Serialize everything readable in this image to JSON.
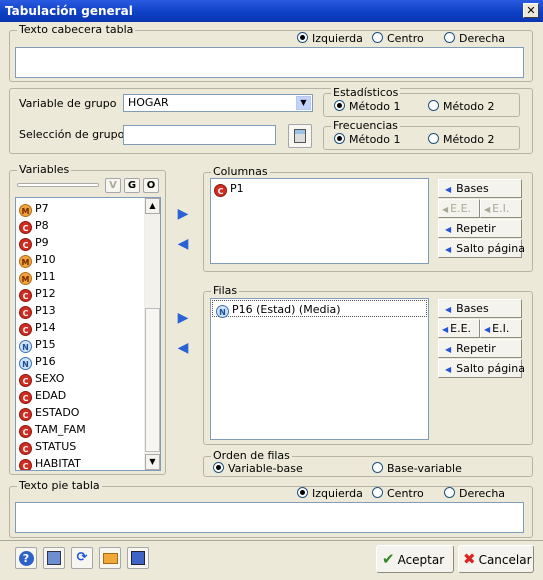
{
  "window": {
    "title": "Tabulación general",
    "close_glyph": "✕"
  },
  "header_text": {
    "label": "Texto cabecera tabla",
    "value": "",
    "alignment_options": [
      {
        "label": "Izquierda",
        "selected": true
      },
      {
        "label": "Centro",
        "selected": false
      },
      {
        "label": "Derecha",
        "selected": false
      }
    ]
  },
  "group_var": {
    "label": "Variable de grupo",
    "value": "HOGAR"
  },
  "group_sel": {
    "label": "Selección de grupo",
    "value": ""
  },
  "estadisticos": {
    "label": "Estadísticos",
    "options": [
      {
        "label": "Método 1",
        "selected": true
      },
      {
        "label": "Método 2",
        "selected": false
      }
    ]
  },
  "frecuencias": {
    "label": "Frecuencias",
    "options": [
      {
        "label": "Método 1",
        "selected": true
      },
      {
        "label": "Método 2",
        "selected": false
      }
    ]
  },
  "variables": {
    "label": "Variables",
    "filter_buttons": [
      "V",
      "G",
      "O"
    ],
    "items": [
      {
        "type": "M",
        "name": "P7"
      },
      {
        "type": "C",
        "name": "P8"
      },
      {
        "type": "C",
        "name": "P9"
      },
      {
        "type": "M",
        "name": "P10"
      },
      {
        "type": "M",
        "name": "P11"
      },
      {
        "type": "C",
        "name": "P12"
      },
      {
        "type": "C",
        "name": "P13"
      },
      {
        "type": "C",
        "name": "P14"
      },
      {
        "type": "N",
        "name": "P15"
      },
      {
        "type": "N",
        "name": "P16"
      },
      {
        "type": "C",
        "name": "SEXO"
      },
      {
        "type": "C",
        "name": "EDAD"
      },
      {
        "type": "C",
        "name": "ESTADO"
      },
      {
        "type": "C",
        "name": "TAM_FAM"
      },
      {
        "type": "C",
        "name": "STATUS"
      },
      {
        "type": "C",
        "name": "HABITAT"
      }
    ]
  },
  "columnas": {
    "label": "Columnas",
    "items": [
      {
        "type": "C",
        "name": "P1"
      }
    ],
    "buttons": {
      "bases": "Bases",
      "ee": "E.E.",
      "ei": "E.I.",
      "repetir": "Repetir",
      "salto": "Salto página"
    }
  },
  "filas": {
    "label": "Filas",
    "items": [
      {
        "type": "N",
        "name": "P16  (Estad)  (Media)"
      }
    ],
    "buttons": {
      "bases": "Bases",
      "ee": "E.E.",
      "ei": "E.I.",
      "repetir": "Repetir",
      "salto": "Salto página"
    }
  },
  "orden": {
    "label": "Orden de filas",
    "options": [
      {
        "label": "Variable-base",
        "selected": true
      },
      {
        "label": "Base-variable",
        "selected": false
      }
    ]
  },
  "footer_text": {
    "label": "Texto pie tabla",
    "value": "",
    "alignment_options": [
      {
        "label": "Izquierda",
        "selected": true
      },
      {
        "label": "Centro",
        "selected": false
      },
      {
        "label": "Derecha",
        "selected": false
      }
    ]
  },
  "actions": {
    "accept": "Aceptar",
    "cancel": "Cancelar"
  }
}
